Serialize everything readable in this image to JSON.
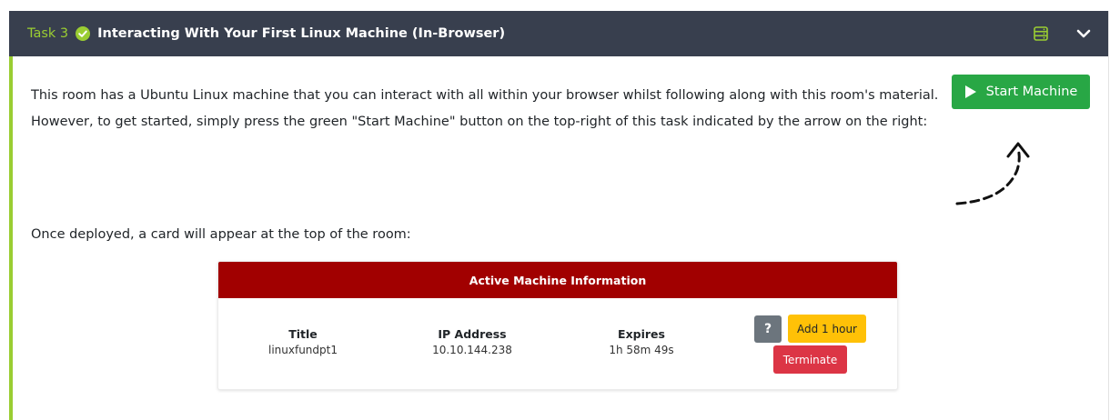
{
  "task": {
    "number": "Task 3",
    "title": "Interacting With Your First Linux Machine (In-Browser)",
    "header_icons": [
      "database-icon",
      "chevron-down-icon"
    ]
  },
  "body": {
    "para1": "This room has a Ubuntu Linux machine that you can interact with all within your browser whilst following along with this room's material.",
    "para2": "However, to get started, simply press the green \"Start Machine\" button on the top-right of this task indicated by the arrow on the right:",
    "para3": "Once deployed, a card will appear at the top of the room:",
    "start_button": "Start Machine"
  },
  "machine_card": {
    "header": "Active Machine Information",
    "columns": [
      {
        "label": "Title",
        "value": "linuxfundpt1"
      },
      {
        "label": "IP Address",
        "value": "10.10.144.238"
      },
      {
        "label": "Expires",
        "value": "1h 58m 49s"
      }
    ],
    "help_button": "?",
    "add_hour_button": "Add 1 hour",
    "terminate_button": "Terminate"
  },
  "colors": {
    "header_bg": "#383f4e",
    "accent_green": "#9acd32",
    "start_green": "#28a745",
    "card_red": "#a10000",
    "add_yellow": "#ffc107",
    "terminate_red": "#dc3545"
  }
}
